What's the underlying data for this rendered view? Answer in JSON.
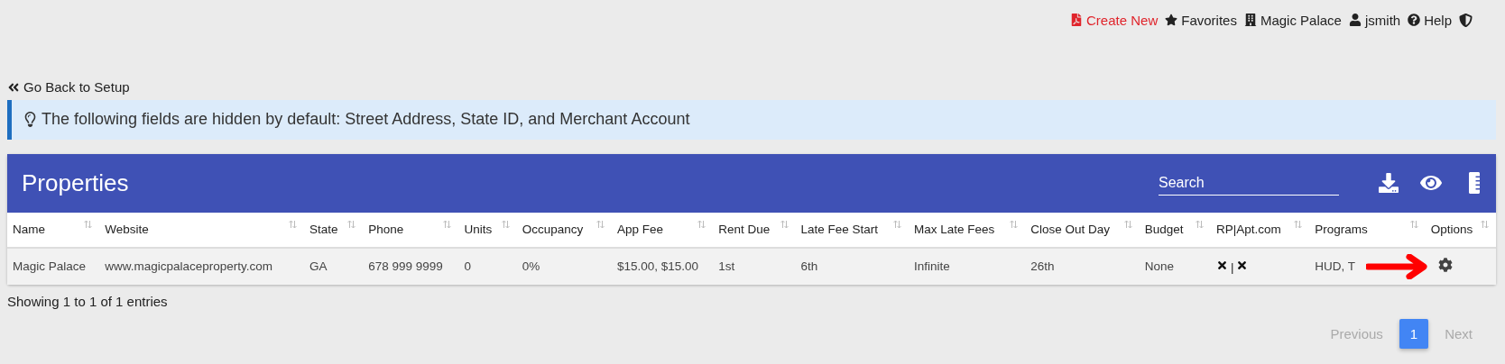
{
  "top_nav": [
    {
      "kind": "create",
      "label": "Create New"
    },
    {
      "kind": "favorites",
      "label": "Favorites"
    },
    {
      "kind": "property",
      "label": "Magic Palace"
    },
    {
      "kind": "user",
      "label": "jsmith"
    },
    {
      "kind": "help",
      "label": "Help"
    },
    {
      "kind": "shield"
    }
  ],
  "back_link": "Go Back to Setup",
  "alert": "The following fields are hidden by default: Street Address, State ID, and Merchant Account",
  "panel": {
    "title": "Properties",
    "search": {
      "placeholder": "Search"
    }
  },
  "table": {
    "columns": [
      "Name",
      "Website",
      "State",
      "Phone",
      "Units",
      "Occupancy",
      "App Fee",
      "Rent Due",
      "Late Fee Start",
      "Max Late Fees",
      "Close Out Day",
      "Budget",
      "RP|Apt.com",
      "Programs",
      "Options"
    ],
    "rows": [
      {
        "cells": [
          "Magic Palace",
          "www.magicpalaceproperty.com",
          "GA",
          "678 999 9999",
          "0",
          "0%",
          "$15.00, $15.00",
          "1st",
          "6th",
          "Infinite",
          "26th",
          "None"
        ],
        "rp": false,
        "separator": "|",
        "apt_com": false,
        "programs": "HUD, T"
      }
    ]
  },
  "info": "Showing 1 to 1 of 1 entries",
  "pagination": [
    {
      "label": "Previous",
      "disabled": true,
      "selected": false
    },
    {
      "label": "1",
      "disabled": false,
      "selected": true
    },
    {
      "label": "Next",
      "disabled": true,
      "selected": false
    }
  ]
}
